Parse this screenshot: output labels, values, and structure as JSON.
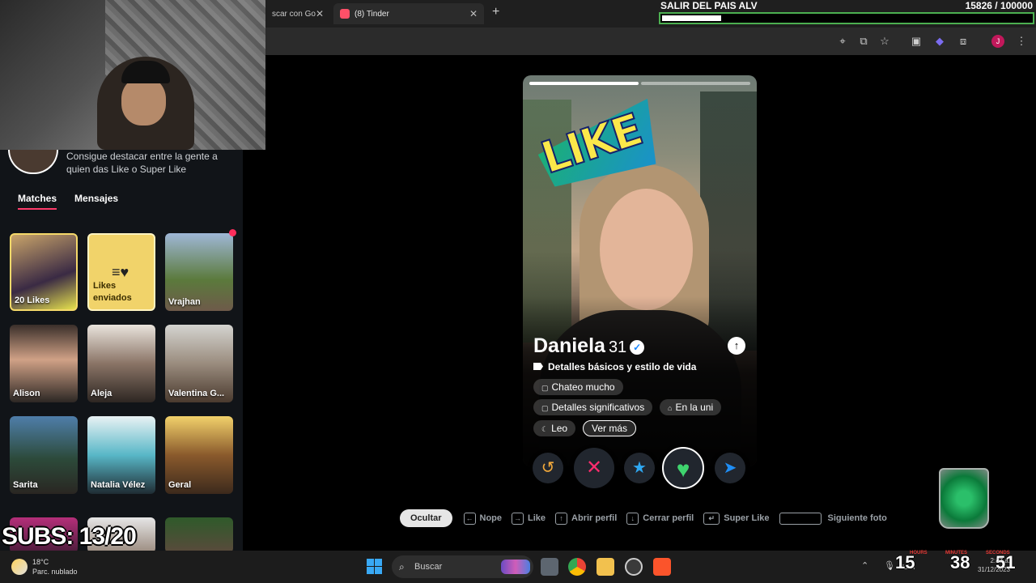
{
  "browser": {
    "tabs": [
      {
        "label": "scar con Go",
        "active": false
      },
      {
        "label": "(8) Tinder",
        "active": true
      }
    ],
    "new_tab": "+",
    "close": "✕"
  },
  "goal_overlay": {
    "title": "SALIR DEL PAIS ALV",
    "count": "15826  / 100000",
    "progress": 0.158
  },
  "sidebar": {
    "promo_text": "Consigue destacar entre la gente a quien das Like o Super Like",
    "tabs": [
      "Matches",
      "Mensajes"
    ],
    "likes_card": "20 Likes",
    "sent_card": "Likes enviados",
    "matches": [
      "Vrajhan",
      "Alison",
      "Aleja",
      "Valentina G...",
      "Sarita",
      "Natalia Vélez",
      "Geral"
    ]
  },
  "subs_overlay": "SUBS: 13/20",
  "profile": {
    "stamp": "LIKE",
    "name": "Daniela",
    "age": "31",
    "details_heading": "Detalles básicos y estilo de vida",
    "chips": [
      "Chateo mucho",
      "Detalles significativos",
      "En la uni",
      "Leo",
      "Ver más"
    ],
    "photo_count": 2,
    "current_photo": 1
  },
  "actions": {
    "rewind": "↺",
    "nope": "✕",
    "superlike": "★",
    "like": "♥",
    "boost": "➤"
  },
  "hints": {
    "hide": "Ocultar",
    "items": [
      "Nope",
      "Like",
      "Abrir perfil",
      "Cerrar perfil",
      "Super Like",
      "Siguiente foto"
    ]
  },
  "taskbar": {
    "temp": "18°C",
    "weather": "Parc. nublado",
    "search": "Buscar",
    "time": "2:47 a.",
    "date": "31/12/2023",
    "lang": "LAA",
    "countdown": {
      "hours": "15",
      "minutes": "38",
      "seconds": "51",
      "hours_label": "HOURS",
      "minutes_label": "MINUTES",
      "seconds_label": "SECONDS"
    }
  },
  "colors": {
    "tinder_accent": "#fd3a6a",
    "goal_border": "#4caf50",
    "likes_gold": "#f1d36a"
  }
}
